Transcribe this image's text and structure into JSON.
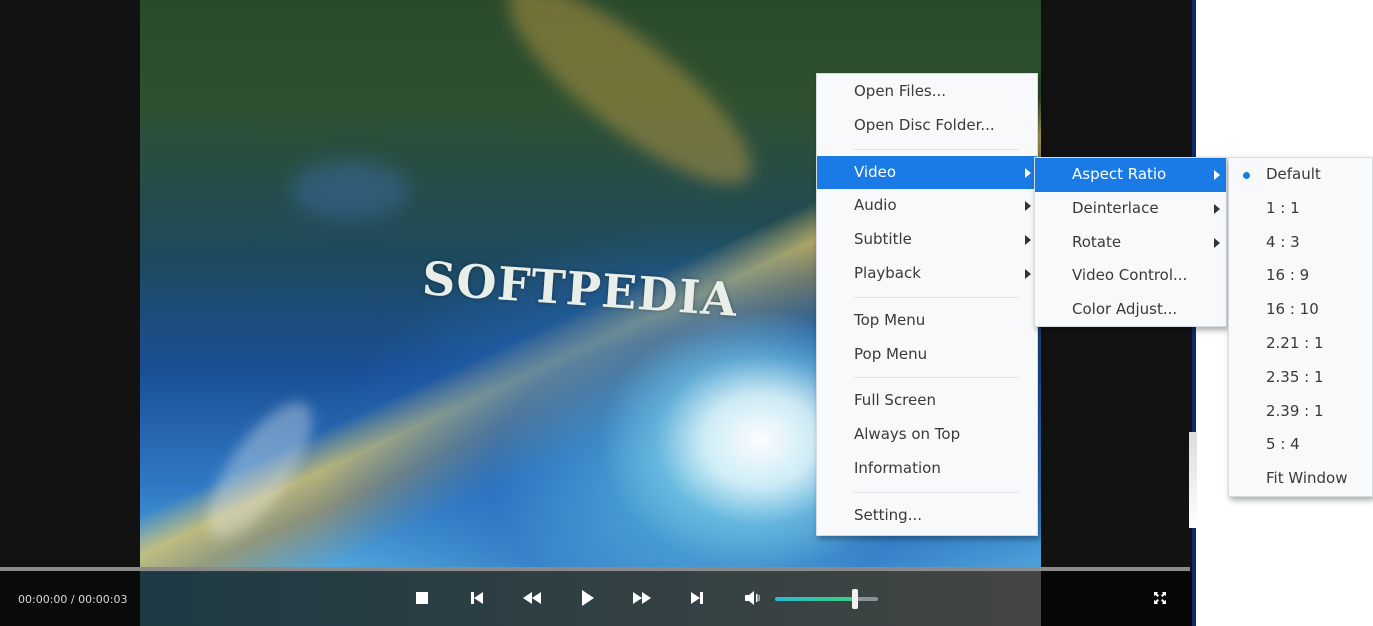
{
  "player": {
    "time_display": "00:00:00 / 00:00:03",
    "watermark_text": "SOFTPEDIA",
    "progress_fraction": 0.0,
    "volume_fraction": 0.78,
    "accent_color": "#1a7be6",
    "controls": [
      {
        "name": "stop-button",
        "icon": "stop-icon"
      },
      {
        "name": "previous-button",
        "icon": "skip-previous-icon"
      },
      {
        "name": "rewind-button",
        "icon": "rewind-icon"
      },
      {
        "name": "play-button",
        "icon": "play-icon"
      },
      {
        "name": "fast-forward-button",
        "icon": "fast-forward-icon"
      },
      {
        "name": "next-button",
        "icon": "skip-next-icon"
      },
      {
        "name": "volume-button",
        "icon": "volume-icon"
      },
      {
        "name": "fullscreen-button",
        "icon": "fullscreen-icon"
      }
    ]
  },
  "context_menu": {
    "items": [
      {
        "label": "Open Files..."
      },
      {
        "label": "Open Disc Folder..."
      },
      {
        "label": "Video",
        "submenu": true,
        "active": true
      },
      {
        "label": "Audio",
        "submenu": true
      },
      {
        "label": "Subtitle",
        "submenu": true
      },
      {
        "label": "Playback",
        "submenu": true
      },
      {
        "label": "Top Menu"
      },
      {
        "label": "Pop Menu"
      },
      {
        "label": "Full Screen"
      },
      {
        "label": "Always on Top"
      },
      {
        "label": "Information"
      },
      {
        "label": "Setting..."
      }
    ]
  },
  "video_submenu": {
    "items": [
      {
        "label": "Aspect Ratio",
        "submenu": true,
        "active": true
      },
      {
        "label": "Deinterlace",
        "submenu": true
      },
      {
        "label": "Rotate",
        "submenu": true
      },
      {
        "label": "Video Control..."
      },
      {
        "label": "Color Adjust..."
      }
    ]
  },
  "aspect_ratio_submenu": {
    "selected": "Default",
    "items": [
      {
        "label": "Default"
      },
      {
        "label": "1 : 1"
      },
      {
        "label": "4 : 3"
      },
      {
        "label": "16 : 9"
      },
      {
        "label": "16 : 10"
      },
      {
        "label": "2.21 : 1"
      },
      {
        "label": "2.35 : 1"
      },
      {
        "label": "2.39 : 1"
      },
      {
        "label": "5 : 4"
      },
      {
        "label": "Fit Window"
      }
    ]
  }
}
